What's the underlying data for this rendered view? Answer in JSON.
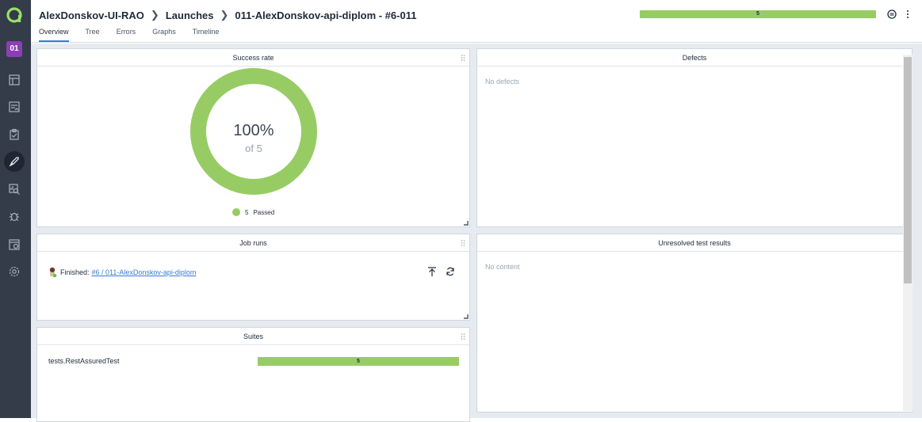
{
  "header": {
    "breadcrumbs": [
      "AlexDonskov-UI-RAO",
      "Launches",
      "011-AlexDonskov-api-diplom - #6-011"
    ],
    "tabs": [
      "Overview",
      "Tree",
      "Errors",
      "Graphs",
      "Timeline"
    ],
    "active_tab": "Overview",
    "status_bar": {
      "label": "5",
      "passed_fraction": 1.0,
      "color": "#97cc64"
    }
  },
  "sidebar": {
    "logo": "allure-logo",
    "project_badge": "01",
    "project_color": "#8b3fb5",
    "items": [
      "dashboard-icon",
      "test-cases-icon",
      "test-plans-icon",
      "launches-icon",
      "analytics-icon",
      "defects-icon",
      "jobs-icon",
      "settings-icon"
    ],
    "active_item": "launches-icon"
  },
  "widgets": {
    "success_rate": {
      "title": "Success rate",
      "percent": "100%",
      "of": "of 5",
      "legend_count": "5",
      "legend_label": "Passed",
      "color": "#97cc64"
    },
    "defects": {
      "title": "Defects",
      "empty": "No defects"
    },
    "job_runs": {
      "title": "Job runs",
      "status": "Finished:",
      "link": "#6 / 011-AlexDonskov-api-diplom"
    },
    "unresolved": {
      "title": "Unresolved test results",
      "empty": "No content"
    },
    "suites": {
      "title": "Suites",
      "rows": [
        {
          "name": "tests.RestAssuredTest",
          "count": "5",
          "passed_fraction": 1.0
        }
      ]
    }
  }
}
